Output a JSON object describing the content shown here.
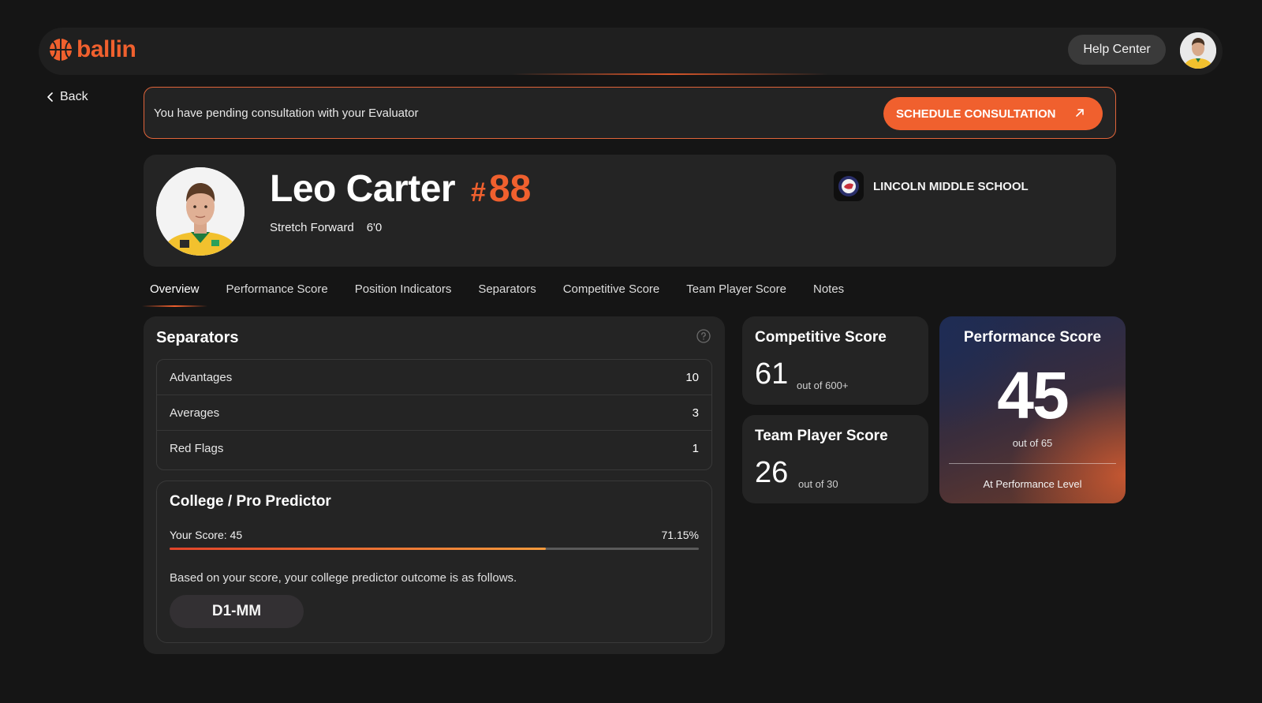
{
  "app": {
    "brand": "ballin",
    "accent": "#f0602e"
  },
  "nav": {
    "help_label": "Help Center"
  },
  "back_label": "Back",
  "banner": {
    "message": "You have pending consultation with your Evaluator",
    "cta": "SCHEDULE CONSULTATION"
  },
  "player": {
    "name": "Leo Carter",
    "hash": "#",
    "number": "88",
    "position": "Stretch Forward",
    "height": "6'0",
    "school": "LINCOLN MIDDLE SCHOOL"
  },
  "tabs": [
    {
      "label": "Overview",
      "active": true
    },
    {
      "label": "Performance Score"
    },
    {
      "label": "Position Indicators"
    },
    {
      "label": "Separators"
    },
    {
      "label": "Competitive Score"
    },
    {
      "label": "Team Player Score"
    },
    {
      "label": "Notes"
    }
  ],
  "separators": {
    "title": "Separators",
    "rows": [
      {
        "label": "Advantages",
        "value": "10"
      },
      {
        "label": "Averages",
        "value": "3"
      },
      {
        "label": "Red Flags",
        "value": "1"
      }
    ]
  },
  "predictor": {
    "title": "College / Pro Predictor",
    "score_label": "Your Score: 45",
    "percent_label": "71.15%",
    "progress": 0.7115,
    "description": "Based on your score, your college predictor outcome is as follows.",
    "outcome": "D1-MM"
  },
  "competitive": {
    "title": "Competitive Score",
    "value": "61",
    "sub": "out of 600+"
  },
  "team_player": {
    "title": "Team Player Score",
    "value": "26",
    "sub": "out of 30"
  },
  "performance": {
    "title": "Performance Score",
    "value": "45",
    "sub": "out of 65",
    "level": "At Performance Level"
  }
}
